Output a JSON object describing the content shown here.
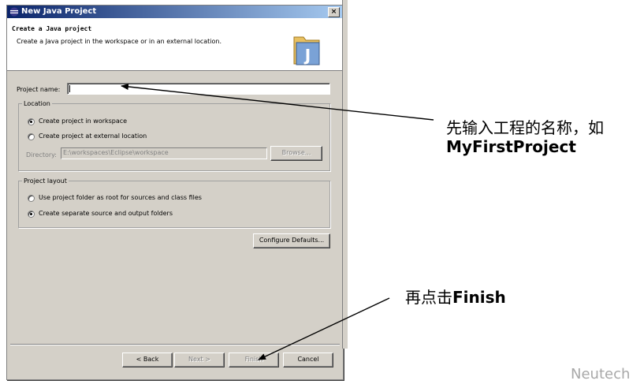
{
  "dialog": {
    "title": "New Java Project",
    "close_label": "×",
    "header_title": "Create a Java project",
    "header_description": "Create a Java project in the workspace or in an external location."
  },
  "project_name": {
    "label": "Project name:",
    "value": ""
  },
  "location": {
    "group_label": "Location",
    "option_workspace": "Create project in workspace",
    "option_external": "Create project at external location",
    "selected": "workspace",
    "directory_label": "Directory:",
    "directory_value": "E:\\workspaces\\Eclipse\\workspace",
    "browse_label": "Browse..."
  },
  "project_layout": {
    "group_label": "Project layout",
    "option_root": "Use project folder as root for sources and class files",
    "option_separate": "Create separate source and output folders",
    "selected": "separate"
  },
  "configure_label": "Configure Defaults...",
  "buttons": {
    "back": "< Back",
    "next": "Next >",
    "finish": "Finish",
    "cancel": "Cancel"
  },
  "annotations": {
    "note1_line1": "先输入工程的名称，如",
    "note1_line2": "MyFirstProject",
    "note2_prefix": "再点击",
    "note2_bold": "Finish",
    "watermark": "Neutech"
  },
  "colors": {
    "titlebar": "#0a246a",
    "dialog_bg": "#d4d0c8",
    "arrow": "#000000"
  }
}
